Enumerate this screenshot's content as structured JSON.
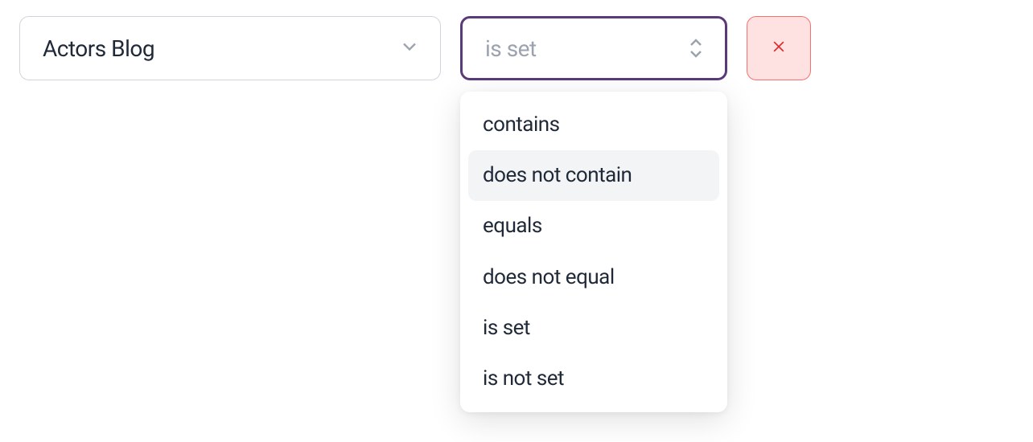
{
  "filter": {
    "field_select": {
      "value": "Actors Blog"
    },
    "condition_select": {
      "placeholder": "is set",
      "options": [
        {
          "label": "contains",
          "highlighted": false
        },
        {
          "label": "does not contain",
          "highlighted": true
        },
        {
          "label": "equals",
          "highlighted": false
        },
        {
          "label": "does not equal",
          "highlighted": false
        },
        {
          "label": "is set",
          "highlighted": false
        },
        {
          "label": "is not set",
          "highlighted": false
        }
      ]
    }
  }
}
